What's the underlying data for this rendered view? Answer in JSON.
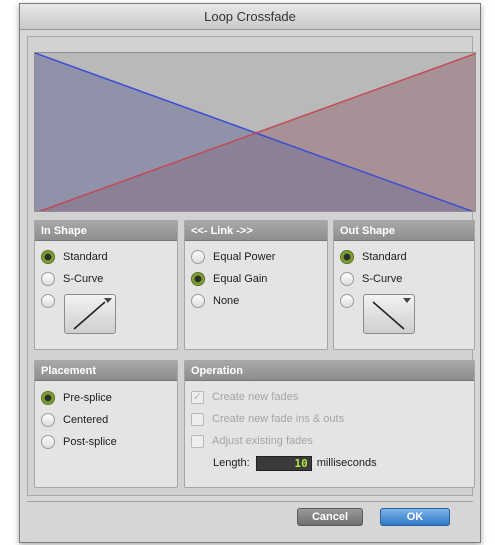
{
  "window": {
    "title": "Loop Crossfade"
  },
  "graph": {
    "fade_out_color": "#3b4bd6",
    "fade_in_color": "#c24a56"
  },
  "in_shape": {
    "header": "In Shape",
    "options": [
      {
        "label": "Standard",
        "selected": true
      },
      {
        "label": "S-Curve",
        "selected": false
      }
    ],
    "custom_shape_icon": "linear-up-curve-icon"
  },
  "link": {
    "header": "<<- Link ->>",
    "options": [
      {
        "label": "Equal Power",
        "selected": false
      },
      {
        "label": "Equal Gain",
        "selected": true
      },
      {
        "label": "None",
        "selected": false
      }
    ]
  },
  "out_shape": {
    "header": "Out Shape",
    "options": [
      {
        "label": "Standard",
        "selected": true
      },
      {
        "label": "S-Curve",
        "selected": false
      }
    ],
    "custom_shape_icon": "linear-down-curve-icon"
  },
  "placement": {
    "header": "Placement",
    "options": [
      {
        "label": "Pre-splice",
        "selected": true
      },
      {
        "label": "Centered",
        "selected": false
      },
      {
        "label": "Post-splice",
        "selected": false
      }
    ]
  },
  "operation": {
    "header": "Operation",
    "checks": [
      {
        "label": "Create new fades",
        "checked": true,
        "disabled": true
      },
      {
        "label": "Create new fade ins & outs",
        "checked": false,
        "disabled": true
      },
      {
        "label": "Adjust existing fades",
        "checked": false,
        "disabled": true
      }
    ],
    "length_label": "Length:",
    "length_value": "10",
    "length_unit": "milliseconds"
  },
  "buttons": {
    "cancel": "Cancel",
    "ok": "OK"
  }
}
